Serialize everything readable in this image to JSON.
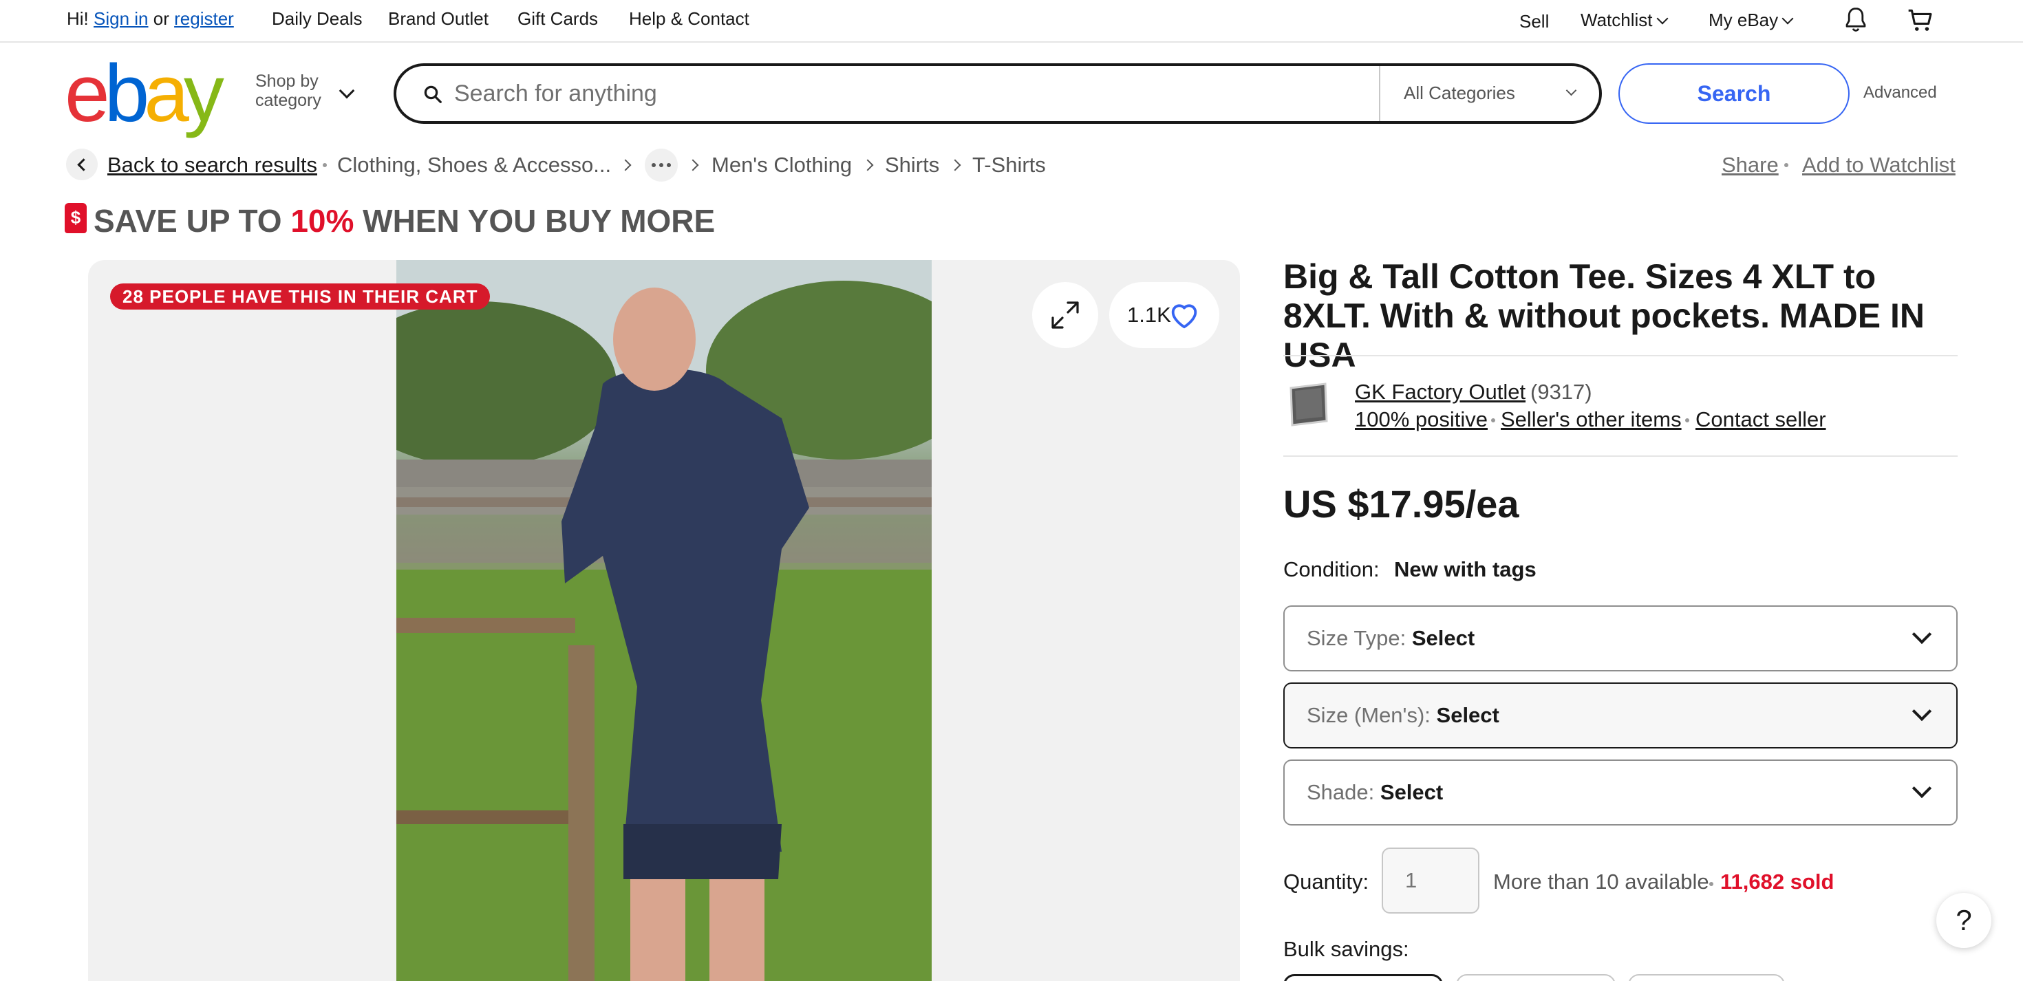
{
  "topbar": {
    "greeting": "Hi!",
    "sign_in": "Sign in",
    "or": "or",
    "register": "register",
    "nav": [
      "Daily Deals",
      "Brand Outlet",
      "Gift Cards",
      "Help & Contact"
    ],
    "sell": "Sell",
    "watchlist": "Watchlist",
    "my_ebay": "My eBay"
  },
  "header": {
    "logo_letters": [
      "e",
      "b",
      "a",
      "y"
    ],
    "logo_colors": [
      "#e53238",
      "#0064d2",
      "#f5af02",
      "#86b817"
    ],
    "shop_by_line1": "Shop by",
    "shop_by_line2": "category",
    "search_placeholder": "Search for anything",
    "category": "All Categories",
    "search_button": "Search",
    "advanced": "Advanced"
  },
  "breadcrumb": {
    "back": "Back to search results",
    "items": [
      "Clothing, Shoes & Accesso...",
      "Men's Clothing",
      "Shirts",
      "T-Shirts"
    ],
    "share": "Share",
    "add_watchlist": "Add to Watchlist"
  },
  "promo": {
    "pre": "SAVE UP TO",
    "pct": "10%",
    "post": "WHEN YOU BUY MORE"
  },
  "gallery": {
    "cart_badge": "28 PEOPLE HAVE THIS IN THEIR CART",
    "watch_count": "1.1K"
  },
  "listing": {
    "title": "Big & Tall Cotton Tee. Sizes 4 XLT to 8XLT. With & without pockets. MADE IN USA",
    "seller_name": "GK Factory Outlet",
    "seller_count": "(9317)",
    "positive": "100% positive",
    "other_items": "Seller's other items",
    "contact": "Contact seller",
    "price": "US $17.95/ea",
    "condition_label": "Condition:",
    "condition_value": "New with tags",
    "selects": [
      {
        "label": "Size Type:",
        "value": "Select"
      },
      {
        "label": "Size (Men's):",
        "value": "Select"
      },
      {
        "label": "Shade:",
        "value": "Select"
      }
    ],
    "quantity_label": "Quantity:",
    "quantity_value": "1",
    "available": "More than 10 available",
    "sold": "11,682 sold",
    "bulk_label": "Bulk savings:"
  },
  "help": "?"
}
